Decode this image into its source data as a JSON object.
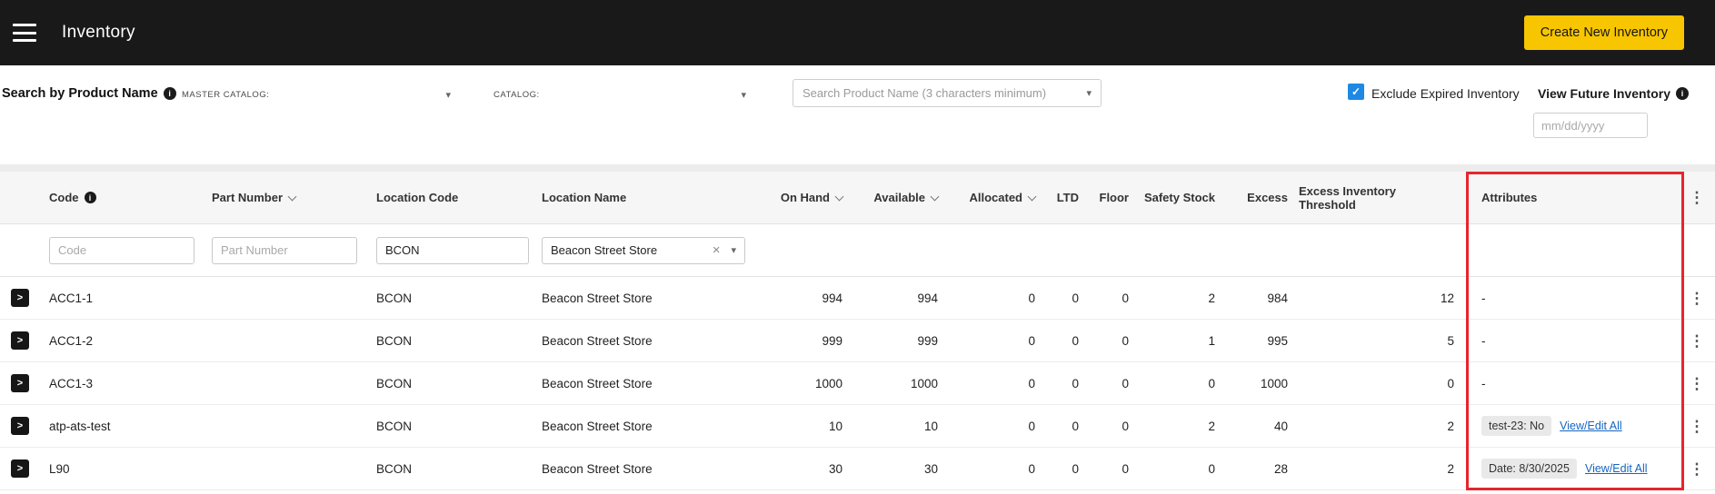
{
  "topbar": {
    "title": "Inventory",
    "create_button": "Create New Inventory"
  },
  "icons": {
    "kebab": "⋮",
    "info": "i",
    "close": "×",
    "check": "✓",
    "expand": ">",
    "caret": "▾"
  },
  "colors": {
    "accent_yellow": "#f7c600",
    "checkbox_blue": "#1e88e5",
    "link_blue": "#1565c0",
    "annotation_red": "#e8252c"
  },
  "filters": {
    "search_by_label": "Search by Product Name",
    "master_catalog_label": "MASTER CATALOG:",
    "catalog_label": "CATALOG:",
    "search_placeholder": "Search Product Name (3 characters minimum)",
    "exclude_expired": "Exclude Expired Inventory",
    "view_future": "View Future Inventory",
    "date_placeholder": "mm/dd/yyyy"
  },
  "table": {
    "headers": {
      "code": "Code",
      "part_number": "Part Number",
      "location_code": "Location Code",
      "location_name": "Location Name",
      "on_hand": "On Hand",
      "available": "Available",
      "allocated": "Allocated",
      "ltd": "LTD",
      "floor": "Floor",
      "safety_stock": "Safety Stock",
      "excess": "Excess",
      "excess_threshold": "Excess Inventory Threshold",
      "attributes": "Attributes"
    },
    "filter_row": {
      "code_placeholder": "Code",
      "part_number_placeholder": "Part Number",
      "location_code_value": "BCON",
      "location_name_value": "Beacon Street Store"
    },
    "rows": [
      {
        "code": "ACC1-1",
        "part_number": "",
        "location_code": "BCON",
        "location_name": "Beacon Street Store",
        "on_hand": "994",
        "available": "994",
        "allocated": "0",
        "ltd": "0",
        "floor": "0",
        "safety_stock": "2",
        "excess": "984",
        "excess_threshold": "12",
        "attributes_text": "-"
      },
      {
        "code": "ACC1-2",
        "part_number": "",
        "location_code": "BCON",
        "location_name": "Beacon Street Store",
        "on_hand": "999",
        "available": "999",
        "allocated": "0",
        "ltd": "0",
        "floor": "0",
        "safety_stock": "1",
        "excess": "995",
        "excess_threshold": "5",
        "attributes_text": "-"
      },
      {
        "code": "ACC1-3",
        "part_number": "",
        "location_code": "BCON",
        "location_name": "Beacon Street Store",
        "on_hand": "1000",
        "available": "1000",
        "allocated": "0",
        "ltd": "0",
        "floor": "0",
        "safety_stock": "0",
        "excess": "1000",
        "excess_threshold": "0",
        "attributes_text": "-"
      },
      {
        "code": "atp-ats-test",
        "part_number": "",
        "location_code": "BCON",
        "location_name": "Beacon Street Store",
        "on_hand": "10",
        "available": "10",
        "allocated": "0",
        "ltd": "0",
        "floor": "0",
        "safety_stock": "2",
        "excess": "40",
        "excess_threshold": "2",
        "attribute_chip": "test-23: No",
        "attributes_link": "View/Edit All"
      },
      {
        "code": "L90",
        "part_number": "",
        "location_code": "BCON",
        "location_name": "Beacon Street Store",
        "on_hand": "30",
        "available": "30",
        "allocated": "0",
        "ltd": "0",
        "floor": "0",
        "safety_stock": "0",
        "excess": "28",
        "excess_threshold": "2",
        "attribute_chip": "Date: 8/30/2025",
        "attributes_link": "View/Edit All"
      }
    ]
  }
}
